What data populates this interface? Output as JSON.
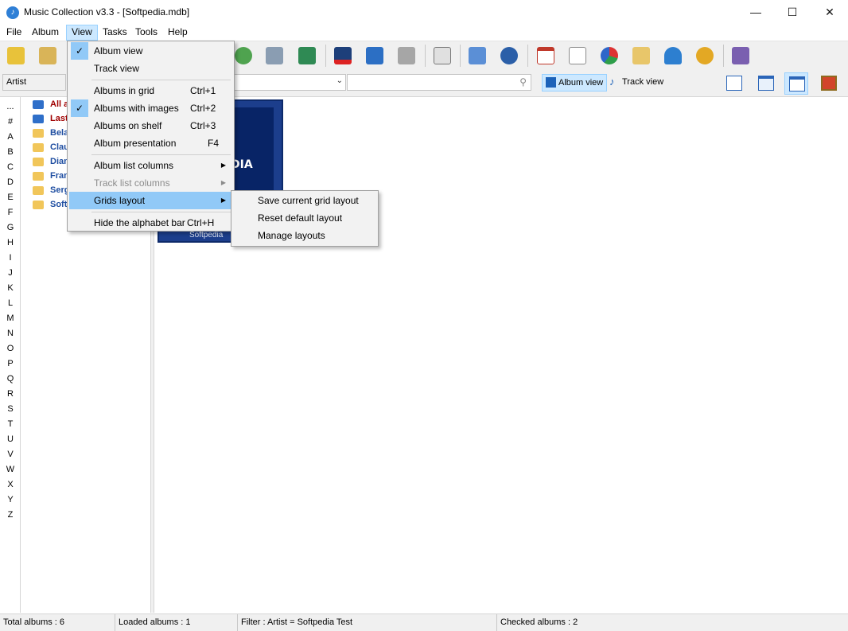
{
  "window": {
    "title": "Music Collection v3.3 - [Softpedia.mdb]",
    "app_icon_glyph": "♪",
    "minimize_glyph": "—",
    "maximize_glyph": "☐",
    "close_glyph": "✕"
  },
  "menubar": {
    "items": [
      "File",
      "Album",
      "View",
      "Tasks",
      "Tools",
      "Help"
    ],
    "active": "View"
  },
  "toolbar": {
    "icons": [
      "new-album-icon",
      "open-database-icon",
      "search-album-icon",
      "find-disc-icon",
      "add-to-collection-icon",
      "remove-album-icon",
      "edit-album-icon",
      "print-icon",
      "html-export-icon",
      "report-icon",
      "music-search-icon",
      "loan-calendar-icon",
      "document-icon",
      "statistics-pie-icon",
      "archive-icon",
      "artists-icon",
      "settings-icon",
      "exit-icon"
    ]
  },
  "filterbar": {
    "group_by": "Artist",
    "search_value": "",
    "album_view_label": "Album view",
    "track_view_label": "Track view",
    "active_view": "Album view"
  },
  "alphabet": [
    "...",
    "#",
    "A",
    "B",
    "C",
    "D",
    "E",
    "F",
    "G",
    "H",
    "I",
    "J",
    "K",
    "L",
    "M",
    "N",
    "O",
    "P",
    "Q",
    "R",
    "S",
    "T",
    "U",
    "V",
    "W",
    "X",
    "Y",
    "Z"
  ],
  "tree": {
    "items": [
      {
        "label": "All a",
        "color": "#a00000",
        "icon": "blue-folder"
      },
      {
        "label": "Last",
        "color": "#a00000",
        "icon": "blue-folder"
      },
      {
        "label": "Bela",
        "color": "#1f4ea1",
        "icon": "yellow-folder"
      },
      {
        "label": "Clau",
        "color": "#1f4ea1",
        "icon": "yellow-folder"
      },
      {
        "label": "Dian",
        "color": "#1f4ea1",
        "icon": "yellow-folder"
      },
      {
        "label": "Fran",
        "color": "#1f4ea1",
        "icon": "yellow-folder"
      },
      {
        "label": "Serg",
        "color": "#1f4ea1",
        "icon": "yellow-folder"
      },
      {
        "label": "Soft",
        "color": "#1f4ea1",
        "icon": "yellow-folder"
      }
    ]
  },
  "album": {
    "cover_text": "DIA",
    "caption": "Softpedia"
  },
  "view_menu": {
    "items": [
      {
        "label": "Album view",
        "shortcut": "",
        "checked": true
      },
      {
        "label": "Track view",
        "shortcut": "",
        "checked": false
      },
      {
        "label": "Albums in grid",
        "shortcut": "Ctrl+1",
        "checked": false
      },
      {
        "label": "Albums with images",
        "shortcut": "Ctrl+2",
        "checked": true
      },
      {
        "label": "Albums on shelf",
        "shortcut": "Ctrl+3",
        "checked": false
      },
      {
        "label": "Album presentation",
        "shortcut": "F4",
        "checked": false
      },
      {
        "label": "Album list columns",
        "shortcut": "",
        "submenu": true
      },
      {
        "label": "Track list columns",
        "shortcut": "",
        "submenu": true,
        "disabled": true
      },
      {
        "label": "Grids layout",
        "shortcut": "",
        "submenu": true,
        "highlighted": true
      },
      {
        "label": "Hide the alphabet bar",
        "shortcut": "Ctrl+H"
      }
    ]
  },
  "grids_layout_submenu": {
    "items": [
      "Save current grid layout",
      "Reset default layout",
      "Manage layouts"
    ]
  },
  "status": {
    "total": "Total albums : 6",
    "loaded": "Loaded albums : 1",
    "filter": "Filter : Artist = Softpedia Test",
    "checked": "Checked albums : 2"
  },
  "colors": {
    "highlight": "#91c9f7",
    "accent": "#cce8ff",
    "cover": "#1c3e8c"
  }
}
